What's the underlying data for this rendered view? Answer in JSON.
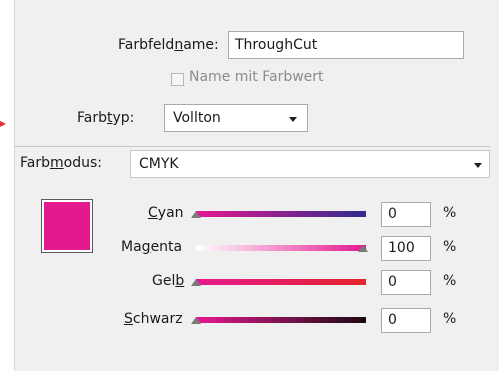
{
  "swatch": {
    "name_label_pre": "Farbfeld",
    "name_label_u": "n",
    "name_label_post": "ame:",
    "name_value": "ThroughCut",
    "name_with_value_label": "Name mit Farbwert",
    "name_with_value_checked": false
  },
  "color_type": {
    "label_pre": "Farb",
    "label_u": "t",
    "label_post": "yp:",
    "value": "Vollton"
  },
  "color_mode": {
    "label_pre": "Farb",
    "label_u": "m",
    "label_post": "odus:",
    "value": "CMYK"
  },
  "preview_color": "#e5198f",
  "channels": [
    {
      "pre": "",
      "u": "C",
      "post": "yan",
      "value": "0",
      "unit": "%"
    },
    {
      "pre": "Ma",
      "u": "g",
      "post": "enta",
      "value": "100",
      "unit": "%"
    },
    {
      "pre": "Gel",
      "u": "b",
      "post": "",
      "value": "0",
      "unit": "%"
    },
    {
      "pre": "",
      "u": "S",
      "post": "chwarz",
      "value": "0",
      "unit": "%"
    }
  ]
}
